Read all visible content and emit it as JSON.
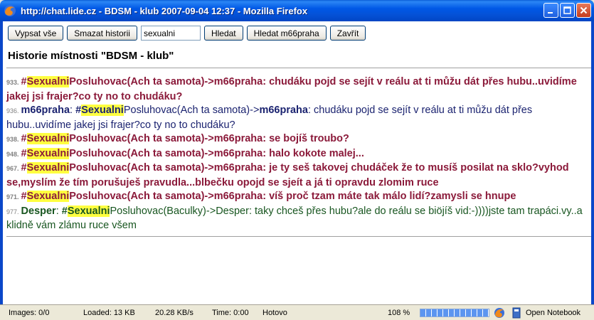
{
  "window": {
    "title": "http://chat.lide.cz - BDSM - klub 2007-09-04 12:37 - Mozilla Firefox",
    "controls": [
      "minimize-icon",
      "maximize-icon",
      "close-icon"
    ]
  },
  "toolbar": {
    "show_all": "Vypsat vše",
    "clear_history": "Smazat historii",
    "search_value": "sexualni",
    "search": "Hledat",
    "search_user": "Hledat m66praha",
    "close": "Zavřít"
  },
  "room_title": "Historie místnosti \"BDSM - klub\"",
  "messages": [
    {
      "num": "933.",
      "hash": "#",
      "hl": "Sexualni",
      "from_rest": "Posluhovac(Ach ta samota)",
      "arrow": "->",
      "to": "m66praha",
      "text": ": chudáku pojd se sejít v reálu at ti můžu dát přes hubu..uvidíme jakej jsi frajer?co ty no to chudáku?"
    },
    {
      "num": "936.",
      "author": "m66praha",
      "sep": ": ",
      "hash": "#",
      "hl": "Sexualni",
      "from_rest": "Posluhovac(Ach ta samota)",
      "arrow": "->",
      "to": "m66praha",
      "text": ": chudáku pojd se sejít v reálu at ti můžu dát přes hubu..uvidíme jakej jsi frajer?co ty no to chudáku?"
    },
    {
      "num": "938.",
      "hash": "#",
      "hl": "Sexualni",
      "from_rest": "Posluhovac(Ach ta samota)",
      "arrow": "->",
      "to": "m66praha",
      "text": ": se bojíš troubo?"
    },
    {
      "num": "948.",
      "hash": "#",
      "hl": "Sexualni",
      "from_rest": "Posluhovac(Ach ta samota)",
      "arrow": "->",
      "to": "m66praha",
      "text": ": halo kokote malej..."
    },
    {
      "num": "967.",
      "hash": "#",
      "hl": "Sexualni",
      "from_rest": "Posluhovac(Ach ta samota)",
      "arrow": "->",
      "to": "m66praha",
      "text": ": je ty seš takovej chudáček že to musíš posilat na sklo?vyhod se,myslím že tím porušuješ pravudla...blbečku opojd se sjeít a já ti opravdu zlomim ruce"
    },
    {
      "num": "971.",
      "hash": "#",
      "hl": "Sexualni",
      "from_rest": "Posluhovac(Ach ta samota)",
      "arrow": "->",
      "to": "m66praha",
      "text": ": víš proč tzam máte tak málo lidí?zamysli se hnupe"
    },
    {
      "num": "977.",
      "author": "Desper",
      "sep": ": ",
      "hash": "#",
      "hl": "Sexualni",
      "from_rest": "Posluhovac(Baculky)",
      "arrow": "->",
      "to": "Desper",
      "text": ": taky chceš přes hubu?ale do reálu se biöjíš vid:-))))jste tam trapáci.vy..a klidně vám zlámu ruce všem"
    }
  ],
  "status": {
    "images": "Images: 0/0",
    "loaded": "Loaded: 13 KB",
    "speed": "20.28 KB/s",
    "time": "Time: 0:00",
    "state": "Hotovo",
    "zoom": "108 %",
    "progress_fraction": 1.0,
    "notebook": "Open Notebook"
  }
}
